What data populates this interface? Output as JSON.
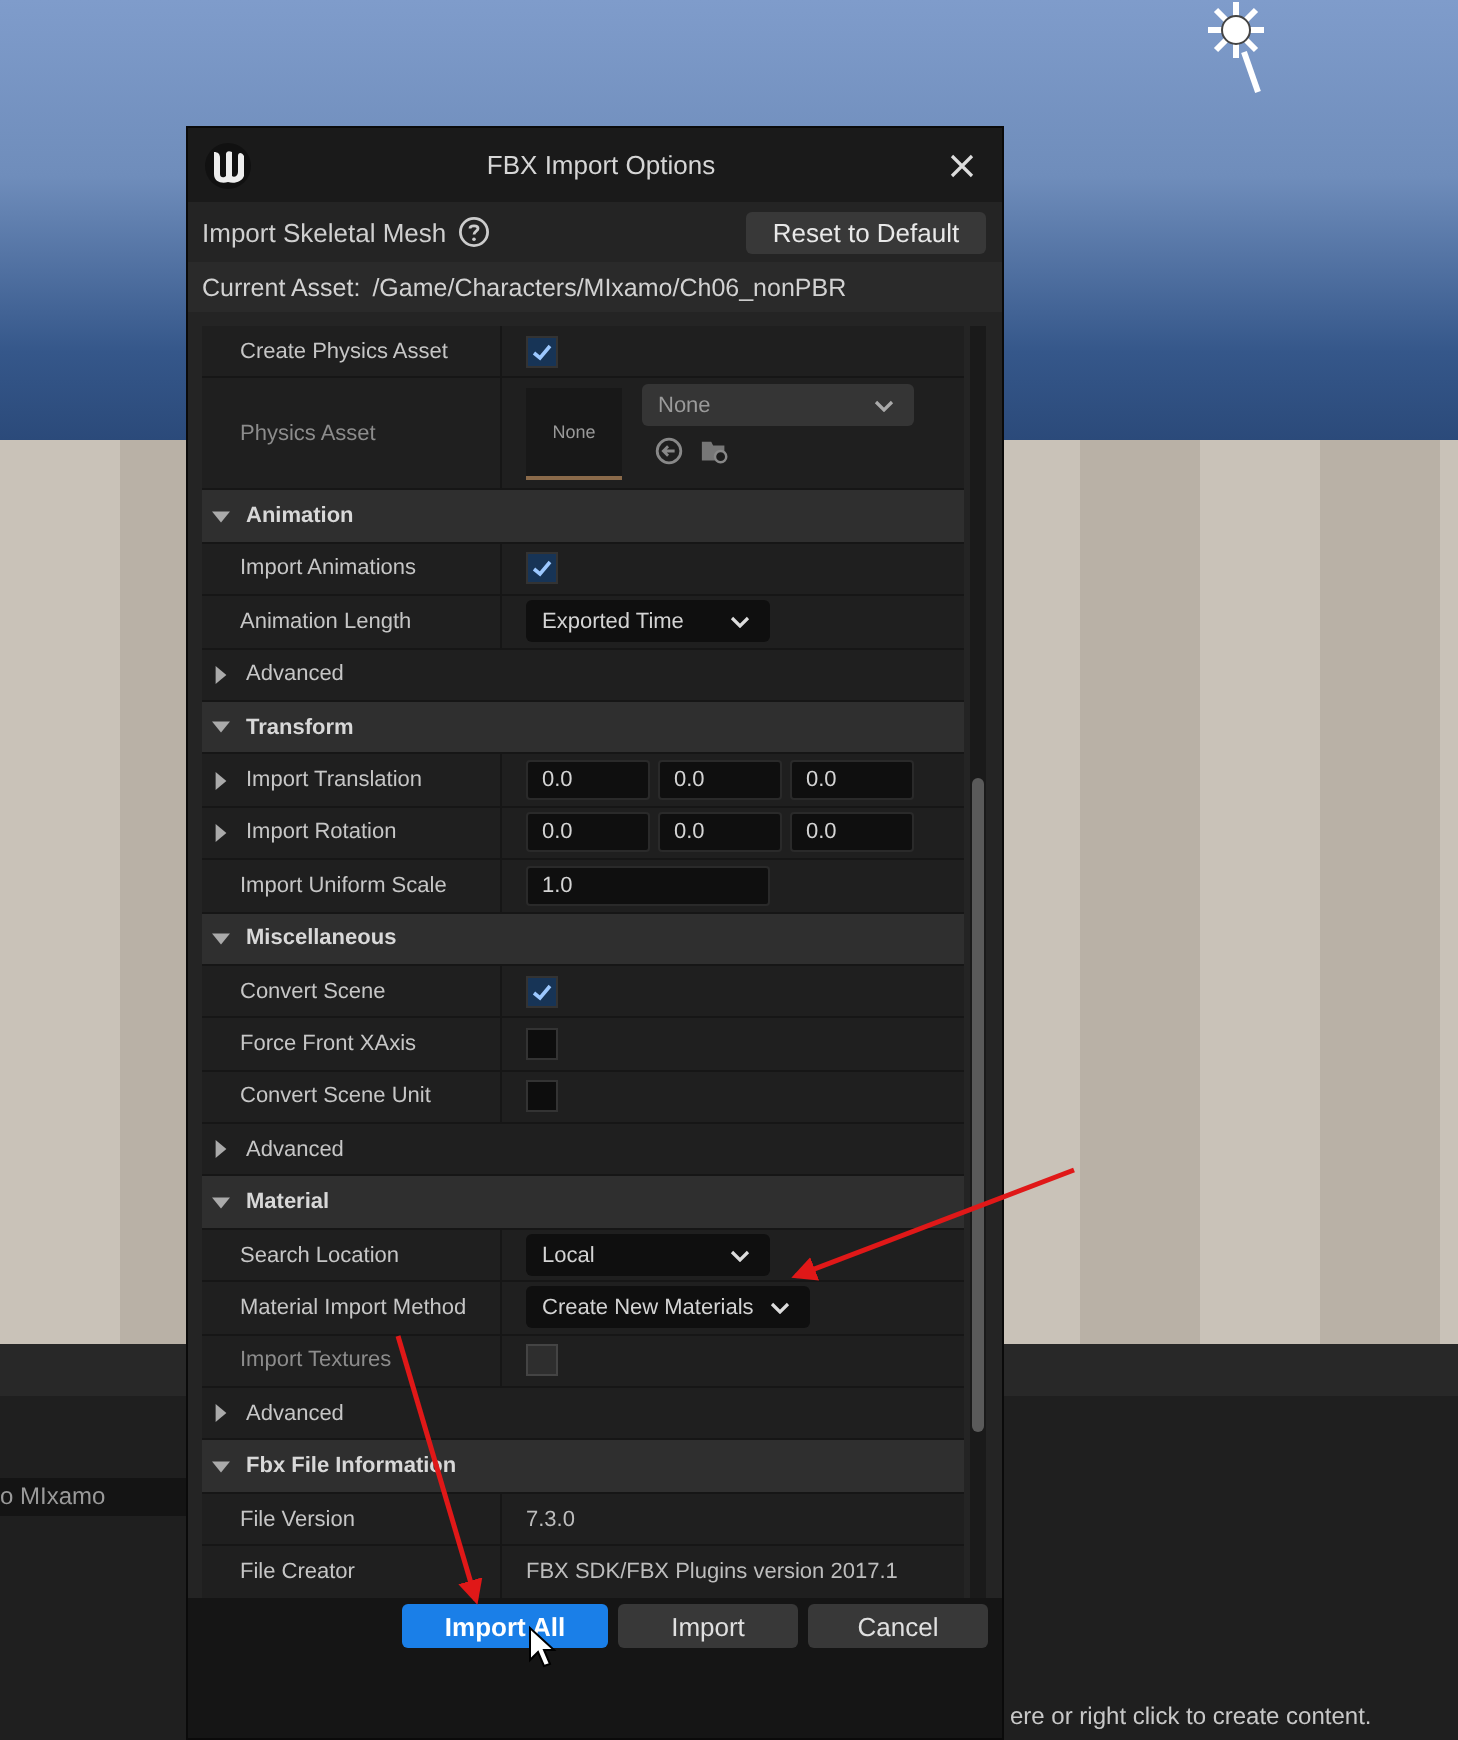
{
  "window": {
    "title": "FBX Import Options"
  },
  "header": {
    "label": "Import Skeletal Mesh",
    "reset_button": "Reset to Default"
  },
  "current_asset": {
    "label": "Current Asset:",
    "value": "/Game/Characters/MIxamo/Ch06_nonPBR"
  },
  "rows": [
    {
      "kind": "checkbox",
      "label": "Create Physics Asset",
      "checked": true,
      "disabled": false
    },
    {
      "kind": "asset",
      "label": "Physics Asset",
      "thumbnail": "None",
      "value": "None",
      "disabled": true
    },
    {
      "kind": "section",
      "label": "Animation",
      "expanded": true
    },
    {
      "kind": "checkbox",
      "label": "Import Animations",
      "checked": true,
      "disabled": false
    },
    {
      "kind": "dropdown",
      "label": "Animation Length",
      "value": "Exported Time",
      "disabled": false
    },
    {
      "kind": "group",
      "label": "Advanced",
      "expanded": false
    },
    {
      "kind": "section",
      "label": "Transform",
      "expanded": true
    },
    {
      "kind": "vector",
      "label": "Import Translation",
      "values": [
        "0.0",
        "0.0",
        "0.0"
      ],
      "expanded": false,
      "disabled": false
    },
    {
      "kind": "vector",
      "label": "Import Rotation",
      "values": [
        "0.0",
        "0.0",
        "0.0"
      ],
      "expanded": false,
      "disabled": false
    },
    {
      "kind": "number",
      "label": "Import Uniform Scale",
      "value": "1.0",
      "disabled": false
    },
    {
      "kind": "section",
      "label": "Miscellaneous",
      "expanded": true
    },
    {
      "kind": "checkbox",
      "label": "Convert Scene",
      "checked": true,
      "disabled": false
    },
    {
      "kind": "checkbox",
      "label": "Force Front XAxis",
      "checked": false,
      "disabled": false
    },
    {
      "kind": "checkbox",
      "label": "Convert Scene Unit",
      "checked": false,
      "disabled": false
    },
    {
      "kind": "group",
      "label": "Advanced",
      "expanded": false
    },
    {
      "kind": "section",
      "label": "Material",
      "expanded": true
    },
    {
      "kind": "dropdown",
      "label": "Search Location",
      "value": "Local",
      "disabled": false
    },
    {
      "kind": "dropdown",
      "label": "Material Import Method",
      "value": "Create New Materials",
      "disabled": false
    },
    {
      "kind": "checkbox",
      "label": "Import Textures",
      "checked": false,
      "disabled": true
    },
    {
      "kind": "group",
      "label": "Advanced",
      "expanded": false
    },
    {
      "kind": "section",
      "label": "Fbx File Information",
      "expanded": true
    },
    {
      "kind": "text",
      "label": "File Version",
      "value": "7.3.0",
      "disabled": false
    },
    {
      "kind": "text",
      "label": "File Creator",
      "value": "FBX SDK/FBX Plugins version 2017.1",
      "disabled": false
    }
  ],
  "buttons": [
    {
      "label": "Import All",
      "kind": "primary"
    },
    {
      "label": "Import",
      "kind": "normal"
    },
    {
      "label": "Cancel",
      "kind": "normal"
    }
  ],
  "content_browser": {
    "search_value": "o MIxamo",
    "hint": "ere or right click to create content."
  }
}
